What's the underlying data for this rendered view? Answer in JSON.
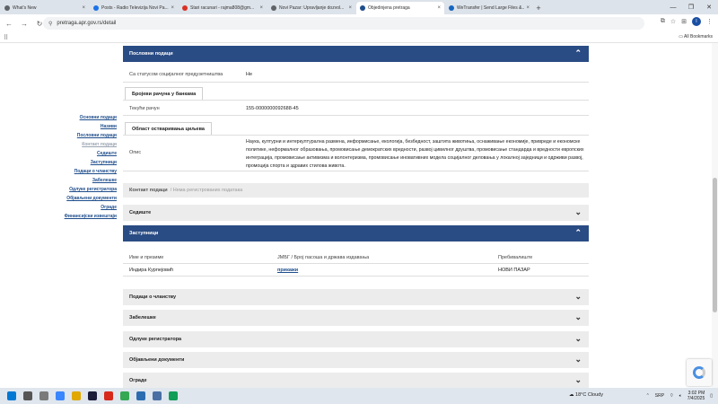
{
  "browser": {
    "tabs": [
      {
        "title": "What's New",
        "color": "#5f6368",
        "active": false
      },
      {
        "title": "Posts - Radio Televizija Novi Pa...",
        "color": "#1a73e8",
        "active": false
      },
      {
        "title": "Stari racunari - rajma808@gm...",
        "color": "#d93025",
        "active": false
      },
      {
        "title": "Novi Pazar: Upravljanje dozvol...",
        "color": "#5f6368",
        "active": false
      },
      {
        "title": "Objedinjena pretraga",
        "color": "#1f4e8c",
        "active": true
      },
      {
        "title": "WeTransfer | Send Large Files &...",
        "color": "#1565c0",
        "active": false
      }
    ],
    "new_tab": "+",
    "url": "pretraga.apr.gov.rs/detail",
    "all_bookmarks": "All Bookmarks",
    "profile_initial": "I"
  },
  "sidenav": [
    {
      "label": "Основни подаци",
      "muted": false
    },
    {
      "label": "Називи",
      "muted": false
    },
    {
      "label": "Пословни подаци",
      "muted": false
    },
    {
      "label": "Контакт подаци",
      "muted": true
    },
    {
      "label": "Седиште",
      "muted": false
    },
    {
      "label": "Заступници",
      "muted": false
    },
    {
      "label": "Подаци о чланству",
      "muted": false
    },
    {
      "label": "Забелешке",
      "muted": false
    },
    {
      "label": "Одлуке регистратора",
      "muted": false
    },
    {
      "label": "Објављени документи",
      "muted": false
    },
    {
      "label": "Ограде",
      "muted": false
    },
    {
      "label": "Финансијски извештаји",
      "muted": false
    }
  ],
  "business": {
    "header": "Пословни подаци",
    "social_label": "Са статусом социјалног предузетништва",
    "social_value": "Не",
    "bank_tab": "Бројеви рачуна у банкама",
    "account_label": "Текући рачун",
    "account_value": "155-0000000092688-45",
    "goals_tab": "Област остваривања циљева",
    "desc_label": "Опис",
    "desc_value": "Наука, културни и интеркултурална размена, информисање, екологија, безбедност, заштита животиња, оснаживање економије, привреде и економске политике, неформалног образовања, промовисање демократских вредности, развој цивилног друштва, промовисање стандарда и вредности европских интеграција, промовисање активизма и волонтеризма, промовисање иновативних модела социјалног деловања у локалној заједници и одрживи развој, промоција спорта и здравих стилова живота."
  },
  "contact": {
    "bold": "Контакт подаци",
    "soft": "/ Нема регистрованих података"
  },
  "seat": {
    "header": "Седиште"
  },
  "reps": {
    "header": "Заступници",
    "columns": [
      "Име и презиме",
      "ЈМБГ / Број пасоша и држава издавања",
      "Пребивалиште"
    ],
    "rows": [
      {
        "name": "Индира Курпејовић",
        "id": "прикажи",
        "residence": "НОВИ ПАЗАР"
      }
    ]
  },
  "collapsed": [
    {
      "header": "Подаци о чланству"
    },
    {
      "header": "Забелешке"
    },
    {
      "header": "Одлуке регистратора"
    },
    {
      "header": "Објављени документи"
    },
    {
      "header": "Ограде"
    }
  ],
  "taskbar": {
    "weather_temp": "18°C",
    "weather_text": "Cloudy",
    "lang": "SRP",
    "time": "3:02 PM",
    "date": "7/4/2025"
  }
}
